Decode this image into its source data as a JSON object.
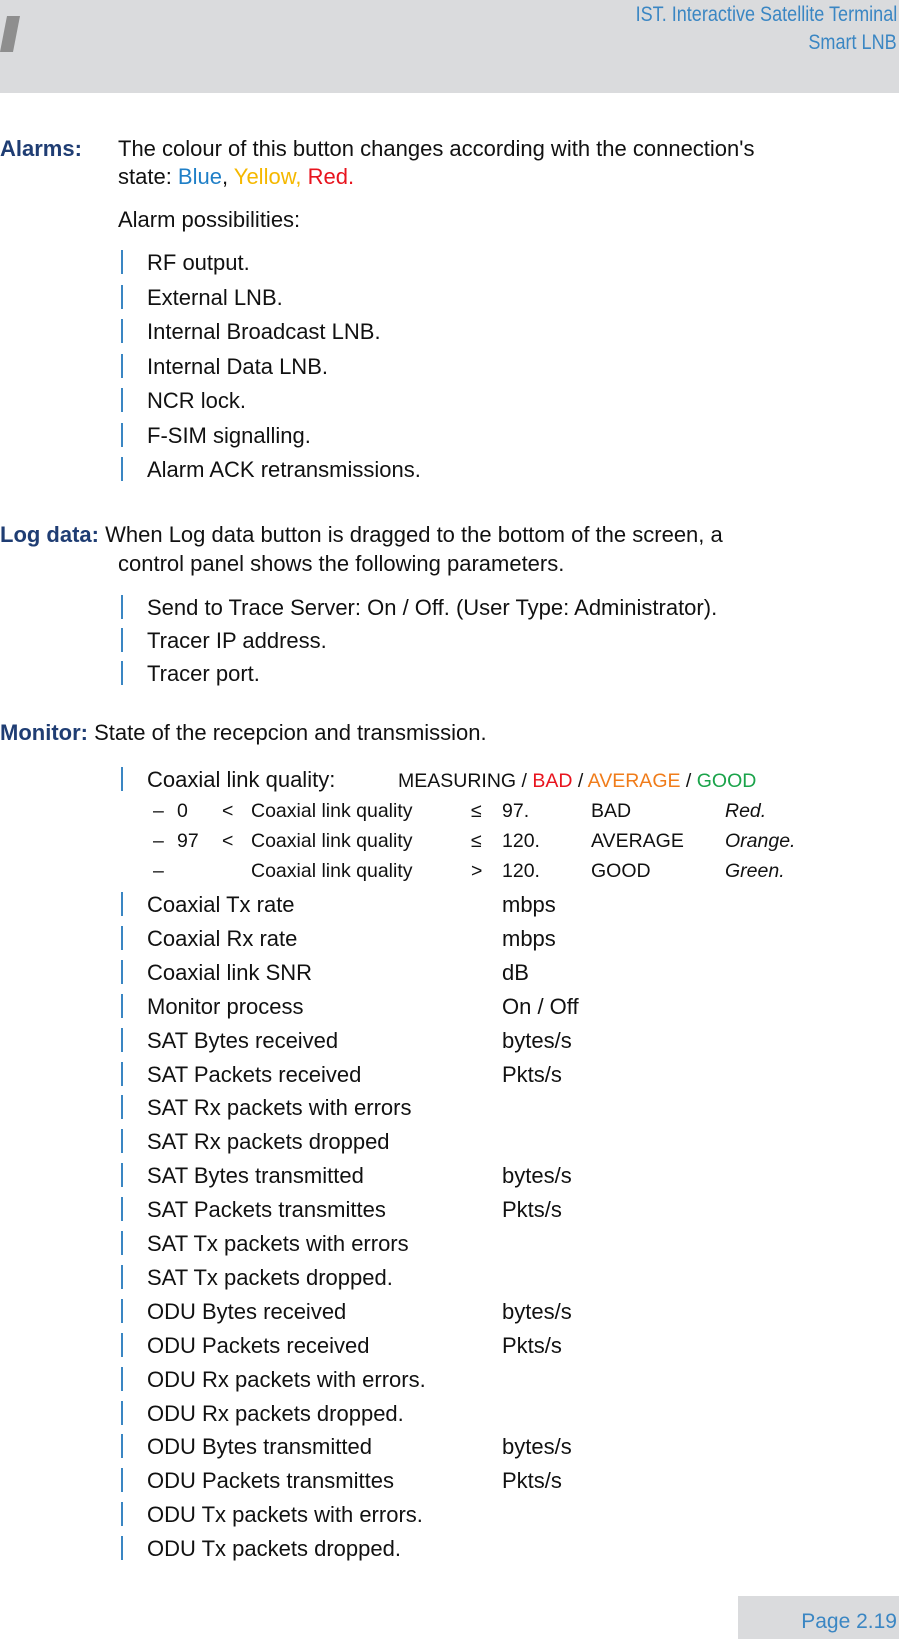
{
  "header": {
    "line1": "IST. Interactive Satellite Terminal",
    "line2": "Smart LNB"
  },
  "alarms": {
    "label": "Alarms:",
    "text1": "The colour of this button changes according with the connection's",
    "text2_prefix": "state: ",
    "color_blue": "Blue",
    "sep": ", ",
    "color_yellow": "Yellow, ",
    "color_red": "Red.",
    "possibilities_title": "Alarm possibilities:",
    "items": [
      "RF output.",
      "External LNB.",
      "Internal Broadcast LNB.",
      "Internal Data LNB.",
      "NCR lock.",
      "F-SIM signalling.",
      "Alarm ACK retransmissions."
    ]
  },
  "log": {
    "label": "Log data:",
    "text1": " When Log data button is dragged to the bottom of the screen, a",
    "text2": "control panel shows the following parameters.",
    "items": [
      "Send to Trace Server: On / Off. (User Type: Administrator).",
      "Tracer IP address.",
      "Tracer port."
    ]
  },
  "monitor": {
    "label": "Monitor:",
    "text": " State of the recepcion and transmission.",
    "quality": {
      "name": "Coaxial link quality:",
      "measuring": "MEASURING / ",
      "bad": "BAD",
      "s1": " / ",
      "average": "AVERAGE",
      "s2": " / ",
      "good": "GOOD"
    },
    "rules": [
      {
        "dash": "–",
        "low": "0",
        "lt": "<",
        "name": "Coaxial link quality",
        "op": "≤",
        "val": "97.",
        "state": "BAD",
        "color": "Red."
      },
      {
        "dash": "–",
        "low": "97",
        "lt": "<",
        "name": "Coaxial link quality",
        "op": "≤",
        "val": "120.",
        "state": "AVERAGE",
        "color": "Orange."
      },
      {
        "dash": "–",
        "low": "",
        "lt": "",
        "name": "Coaxial link quality",
        "op": ">",
        "val": "120.",
        "state": "GOOD",
        "color": "Green."
      }
    ],
    "params": [
      {
        "name": "Coaxial Tx rate",
        "unit": "mbps"
      },
      {
        "name": "Coaxial Rx rate",
        "unit": "mbps"
      },
      {
        "name": "Coaxial link SNR",
        "unit": "dB"
      },
      {
        "name": "Monitor process",
        "unit": "On / Off"
      },
      {
        "name": "SAT Bytes received",
        "unit": "bytes/s"
      },
      {
        "name": "SAT Packets received",
        "unit": "Pkts/s"
      },
      {
        "name": "SAT Rx packets with errors",
        "unit": ""
      },
      {
        "name": "SAT Rx packets dropped",
        "unit": ""
      },
      {
        "name": "SAT Bytes transmitted",
        "unit": "bytes/s"
      },
      {
        "name": "SAT Packets transmittes",
        "unit": "Pkts/s"
      },
      {
        "name": "SAT Tx packets with errors",
        "unit": ""
      },
      {
        "name": "SAT Tx packets dropped.",
        "unit": ""
      },
      {
        "name": "ODU Bytes received",
        "unit": "bytes/s"
      },
      {
        "name": "ODU Packets received",
        "unit": "Pkts/s"
      },
      {
        "name": "ODU Rx packets with errors.",
        "unit": ""
      },
      {
        "name": "ODU Rx packets dropped.",
        "unit": ""
      },
      {
        "name": "ODU Bytes transmitted",
        "unit": "bytes/s"
      },
      {
        "name": "ODU Packets transmittes",
        "unit": "Pkts/s"
      },
      {
        "name": "ODU Tx packets with errors.",
        "unit": ""
      },
      {
        "name": "ODU Tx packets dropped.",
        "unit": ""
      }
    ]
  },
  "footer": {
    "page": "Page 2.19"
  }
}
